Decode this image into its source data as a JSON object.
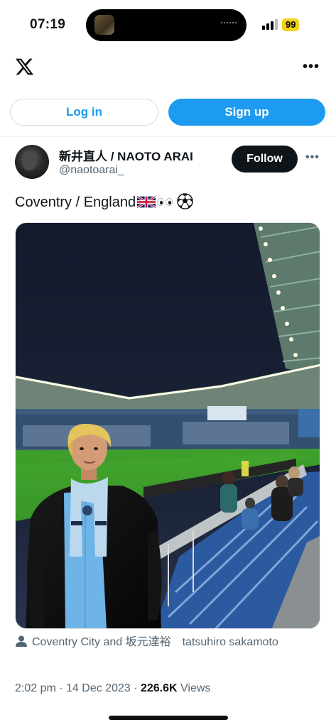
{
  "status_bar": {
    "time": "07:19",
    "battery": "99",
    "battery_color": "#f2d21b"
  },
  "header": {
    "logo_icon": "x-logo-icon",
    "more_icon": "more-horizontal-icon"
  },
  "auth": {
    "login_label": "Log in",
    "signup_label": "Sign up",
    "accent_color": "#1d9bf0"
  },
  "tweet": {
    "author": {
      "display_name": "新井直人 / NAOTO ARAI",
      "handle": "@naotoarai_"
    },
    "follow_label": "Follow",
    "text": "Coventry / England",
    "emojis": [
      "uk-flag",
      "eyes",
      "soccer-ball"
    ],
    "photo_icon": "stadium-photo",
    "tagged": {
      "icon": "person-icon",
      "text": "Coventry City and 坂元達裕　tatsuhiro sakamoto"
    },
    "meta": {
      "time": "2:02 pm",
      "separator1": " · ",
      "date": "14 Dec 2023",
      "separator2": " · ",
      "views_count": "226.6K",
      "views_label": " Views"
    }
  }
}
